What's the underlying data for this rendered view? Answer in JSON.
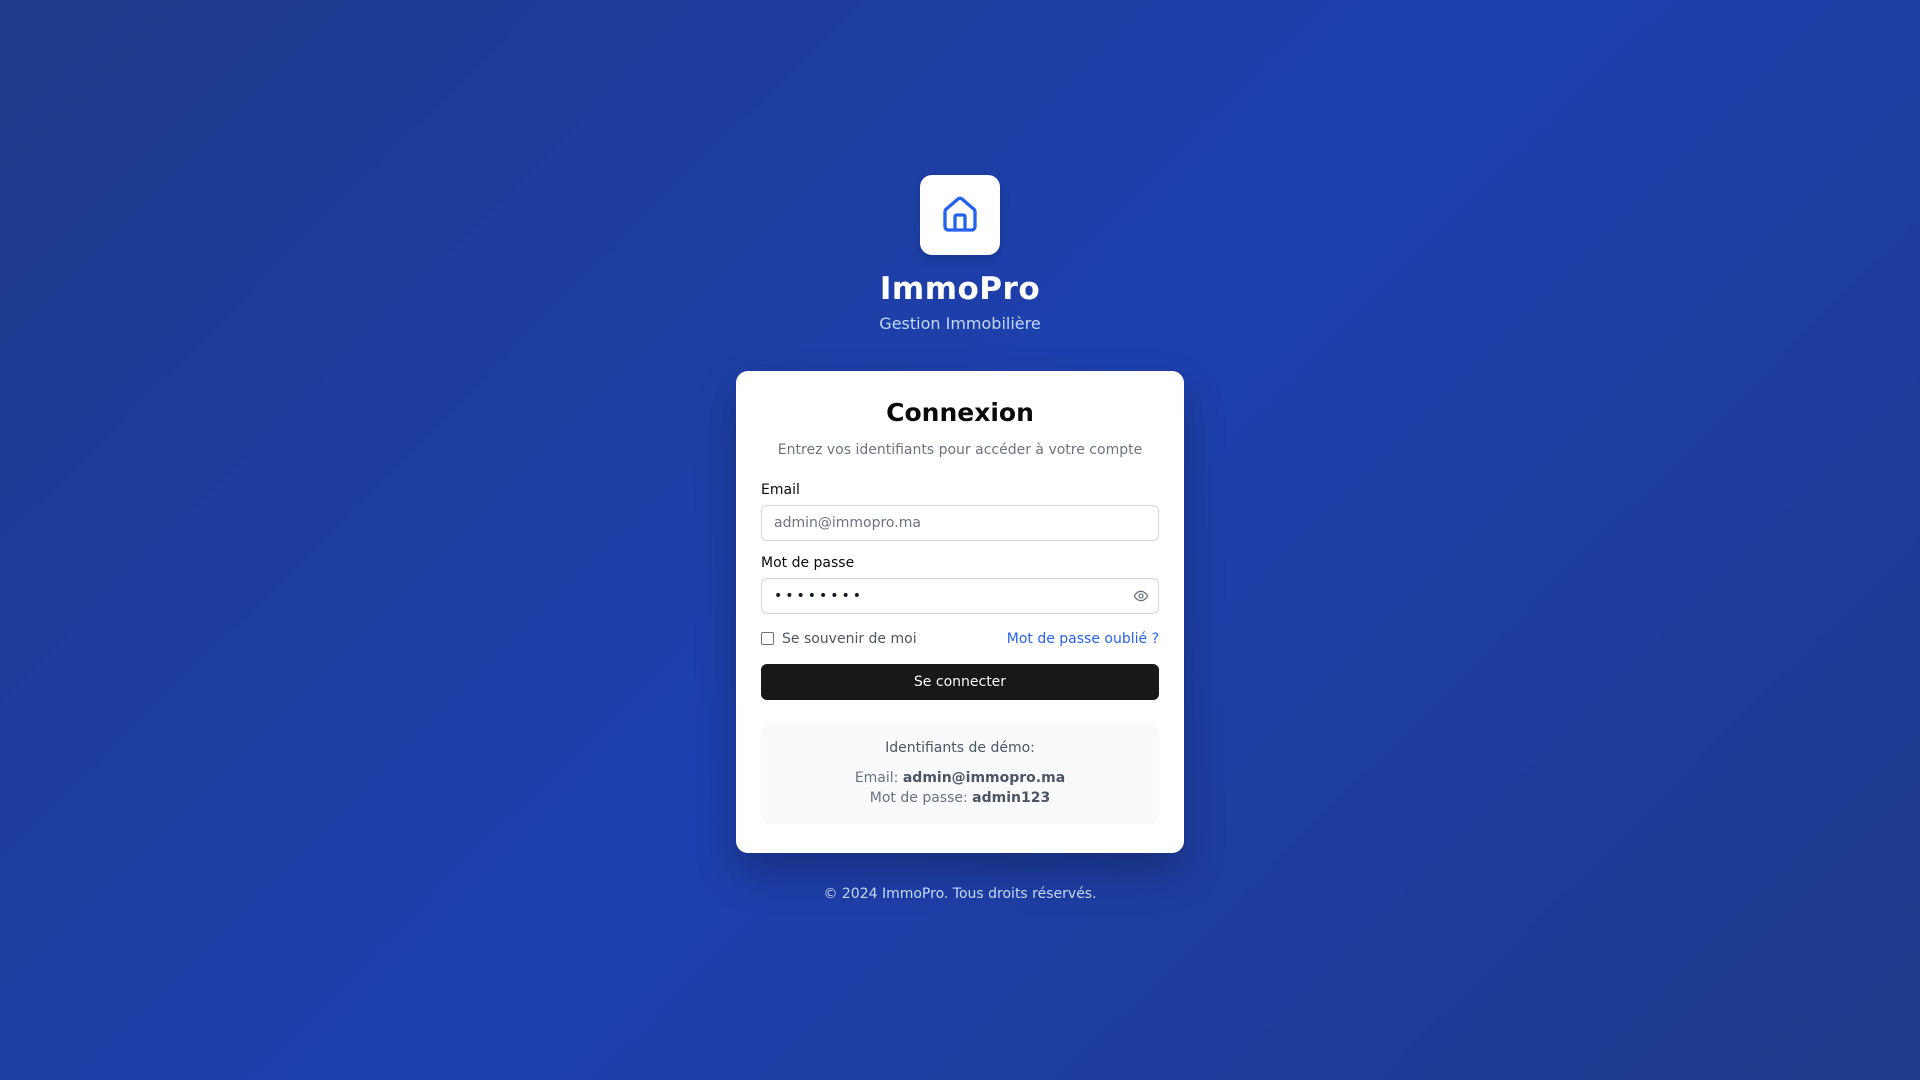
{
  "brand": {
    "icon": "home-icon",
    "title": "ImmoPro",
    "subtitle": "Gestion Immobilière"
  },
  "login": {
    "title": "Connexion",
    "description": "Entrez vos identifiants pour accéder à votre compte",
    "email_label": "Email",
    "email_placeholder": "admin@immopro.ma",
    "email_value": "",
    "password_label": "Mot de passe",
    "password_value": "••••••••",
    "show_password_icon": "eye-icon",
    "remember_label": "Se souvenir de moi",
    "remember_checked": false,
    "forgot_label": "Mot de passe oublié ?",
    "submit_label": "Se connecter"
  },
  "demo": {
    "title": "Identifiants de démo:",
    "email_prefix": "Email:",
    "email_value": "admin@immopro.ma",
    "password_prefix": "Mot de passe:",
    "password_value": "admin123"
  },
  "footer": {
    "text": "© 2024 ImmoPro. Tous droits réservés."
  },
  "colors": {
    "background": "#1e40af",
    "accent": "#2563eb",
    "button": "#18181b"
  }
}
